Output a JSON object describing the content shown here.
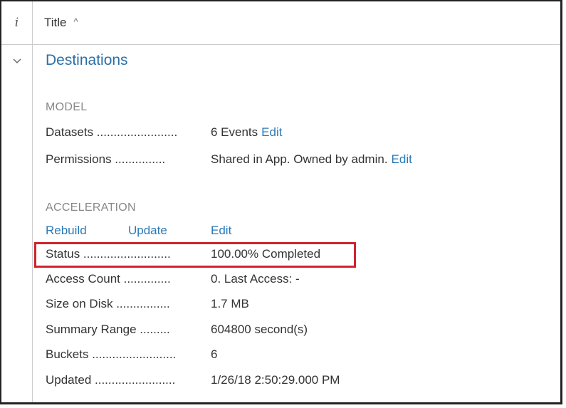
{
  "header": {
    "info_label": "i",
    "title_label": "Title",
    "sort_indicator": "^"
  },
  "model_name": "Destinations",
  "model_section": {
    "heading": "MODEL",
    "datasets": {
      "label": "Datasets ........................",
      "value": "6 Events",
      "action": "Edit"
    },
    "permissions": {
      "label": "Permissions ...............",
      "value": "Shared in App. Owned by admin.",
      "action": "Edit"
    }
  },
  "acceleration_section": {
    "heading": "ACCELERATION",
    "actions": {
      "rebuild": "Rebuild",
      "update": "Update",
      "edit": "Edit"
    },
    "rows": [
      {
        "label": "Status ..........................",
        "value": "100.00% Completed"
      },
      {
        "label": "Access Count ..............",
        "value": "0. Last Access: -"
      },
      {
        "label": "Size on Disk ................",
        "value": "1.7 MB"
      },
      {
        "label": "Summary Range .........",
        "value": "604800 second(s)"
      },
      {
        "label": "Buckets .........................",
        "value": "6"
      },
      {
        "label": "Updated ........................",
        "value": "1/26/18 2:50:29.000 PM"
      }
    ]
  },
  "colors": {
    "link": "#2a7ab8",
    "title": "#2a6fa8",
    "highlight": "#d2222d"
  },
  "icons": {
    "expand": "chevron-down-icon",
    "sort": "sort-ascending-icon"
  }
}
